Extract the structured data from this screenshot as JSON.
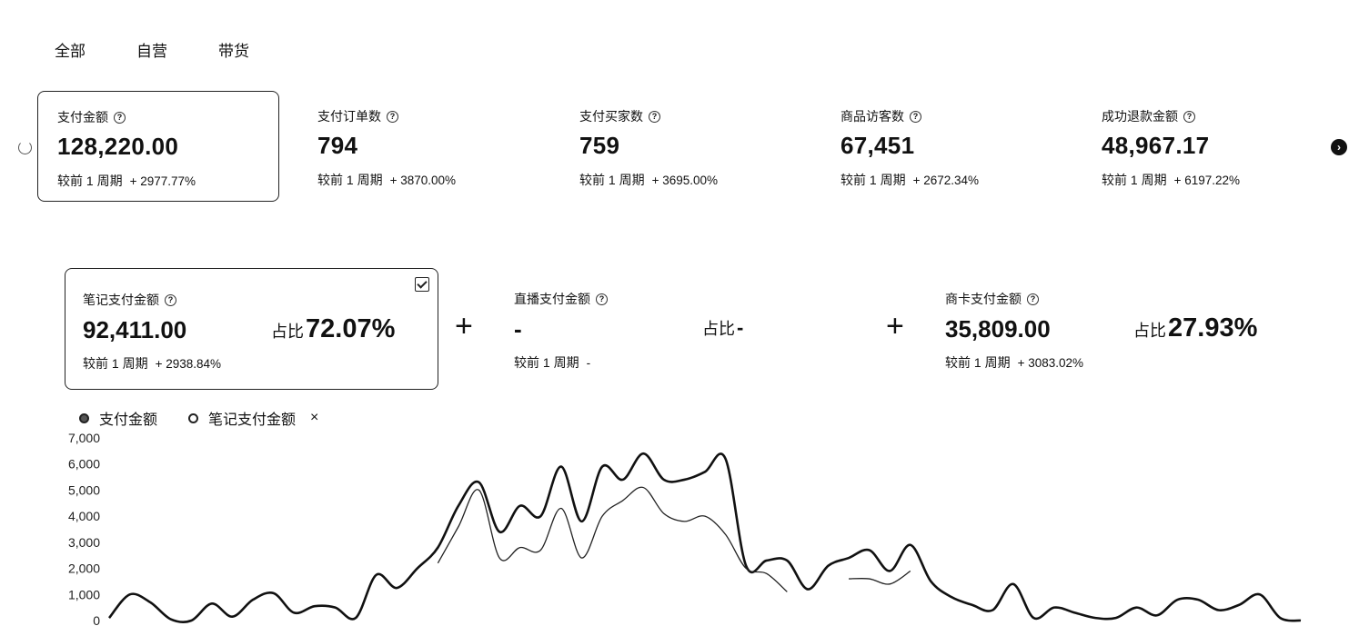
{
  "tabs": [
    "全部",
    "自营",
    "带货"
  ],
  "metrics": [
    {
      "label": "支付金额",
      "value": "128,220.00",
      "compare_label": "较前 1 周期",
      "change": "+ 2977.77%",
      "selected": true
    },
    {
      "label": "支付订单数",
      "value": "794",
      "compare_label": "较前 1 周期",
      "change": "+ 3870.00%",
      "selected": false
    },
    {
      "label": "支付买家数",
      "value": "759",
      "compare_label": "较前 1 周期",
      "change": "+ 3695.00%",
      "selected": false
    },
    {
      "label": "商品访客数",
      "value": "67,451",
      "compare_label": "较前 1 周期",
      "change": "+ 2672.34%",
      "selected": false
    },
    {
      "label": "成功退款金额",
      "value": "48,967.17",
      "compare_label": "较前 1 周期",
      "change": "+ 6197.22%",
      "selected": false
    }
  ],
  "breakdown": [
    {
      "label": "笔记支付金额",
      "value": "92,411.00",
      "share_label": "占比",
      "share": "72.07%",
      "compare_label": "较前 1 周期",
      "change": "+ 2938.84%",
      "selected": true
    },
    {
      "label": "直播支付金额",
      "value": "-",
      "share_label": "占比",
      "share": "-",
      "compare_label": "较前 1 周期",
      "change": "-",
      "selected": false
    },
    {
      "label": "商卡支付金额",
      "value": "35,809.00",
      "share_label": "占比",
      "share": "27.93%",
      "compare_label": "较前 1 周期",
      "change": "+ 3083.02%",
      "selected": false
    }
  ],
  "plus_sign": "+",
  "help_glyph": "?",
  "next_glyph": "›",
  "legend": {
    "items": [
      "支付金额",
      "笔记支付金额"
    ],
    "close_glyph": "×"
  },
  "chart_data": {
    "type": "line",
    "yticks": [
      "7,000",
      "6,000",
      "5,000",
      "4,000",
      "3,000",
      "2,000",
      "1,000",
      "0"
    ],
    "ylim": [
      0,
      7000
    ],
    "series": [
      {
        "name": "支付金额",
        "values": [
          100,
          1000,
          700,
          50,
          0,
          650,
          150,
          800,
          1050,
          300,
          550,
          500,
          100,
          1750,
          1250,
          2000,
          2800,
          4400,
          5300,
          3400,
          4400,
          4000,
          5900,
          3800,
          5900,
          5400,
          6400,
          5400,
          5400,
          5700,
          6200,
          2100,
          2300,
          2300,
          1200,
          2100,
          2400,
          2700,
          1900,
          2900,
          1500,
          900,
          600,
          400,
          1400,
          100,
          500,
          300,
          100,
          100,
          500,
          200,
          800,
          800,
          400,
          600,
          1000,
          100,
          0
        ]
      },
      {
        "name": "笔记支付金额",
        "values": [
          null,
          null,
          null,
          null,
          null,
          null,
          null,
          null,
          null,
          null,
          null,
          null,
          null,
          null,
          null,
          null,
          2200,
          3600,
          5000,
          2400,
          2800,
          2700,
          4300,
          2400,
          4000,
          4600,
          5100,
          4100,
          3800,
          4000,
          3300,
          2000,
          1800,
          1100,
          null,
          null,
          1600,
          1600,
          1400,
          1900,
          null,
          null,
          null,
          null,
          null,
          null,
          null,
          null,
          null,
          null,
          null,
          null,
          null,
          null,
          null,
          null,
          null,
          null,
          null
        ]
      }
    ]
  }
}
